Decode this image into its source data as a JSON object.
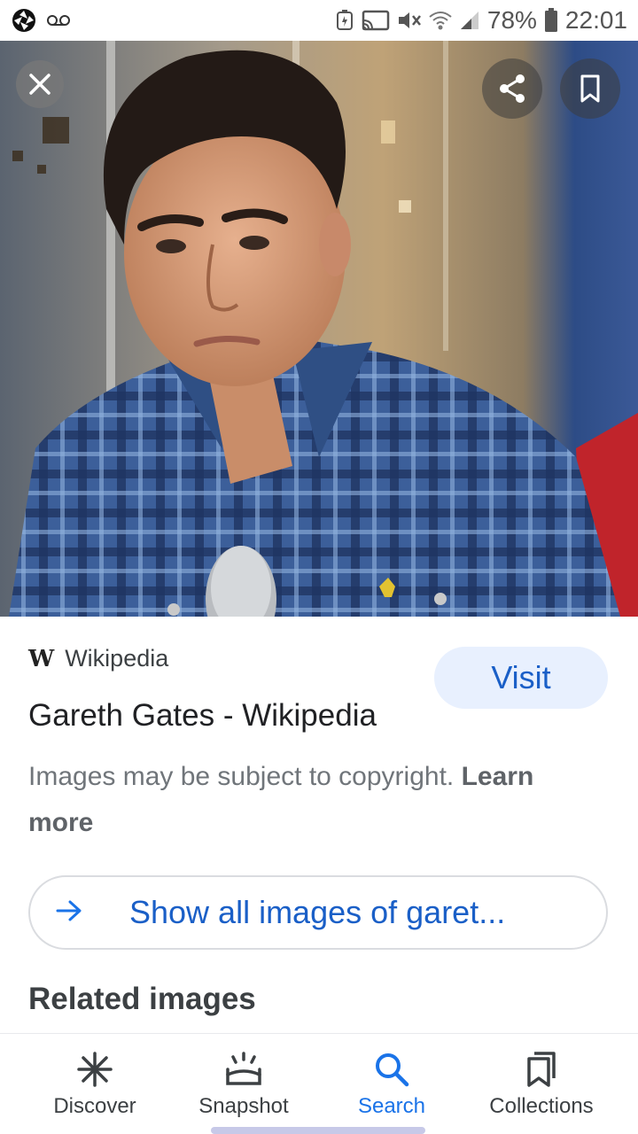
{
  "status_bar": {
    "battery": "78%",
    "time": "22:01"
  },
  "image_viewer": {
    "close_label": "close",
    "share_label": "share",
    "bookmark_label": "bookmark"
  },
  "result": {
    "source_logo": "W",
    "source_name": "Wikipedia",
    "title": "Gareth Gates - Wikipedia",
    "visit_label": "Visit",
    "copyright_text": "Images may be subject to copyright.",
    "learn_more": "Learn more"
  },
  "show_all": {
    "label": "Show all images of garet..."
  },
  "related": {
    "heading": "Related images"
  },
  "bottom_nav": {
    "items": [
      {
        "label": "Discover",
        "icon": "asterisk-icon",
        "active": false
      },
      {
        "label": "Snapshot",
        "icon": "snapshot-icon",
        "active": false
      },
      {
        "label": "Search",
        "icon": "search-icon",
        "active": true
      },
      {
        "label": "Collections",
        "icon": "collections-icon",
        "active": false
      }
    ]
  },
  "colors": {
    "accent": "#1a73e8",
    "link": "#1a5fc7",
    "visit_bg": "#e8f0fe"
  }
}
